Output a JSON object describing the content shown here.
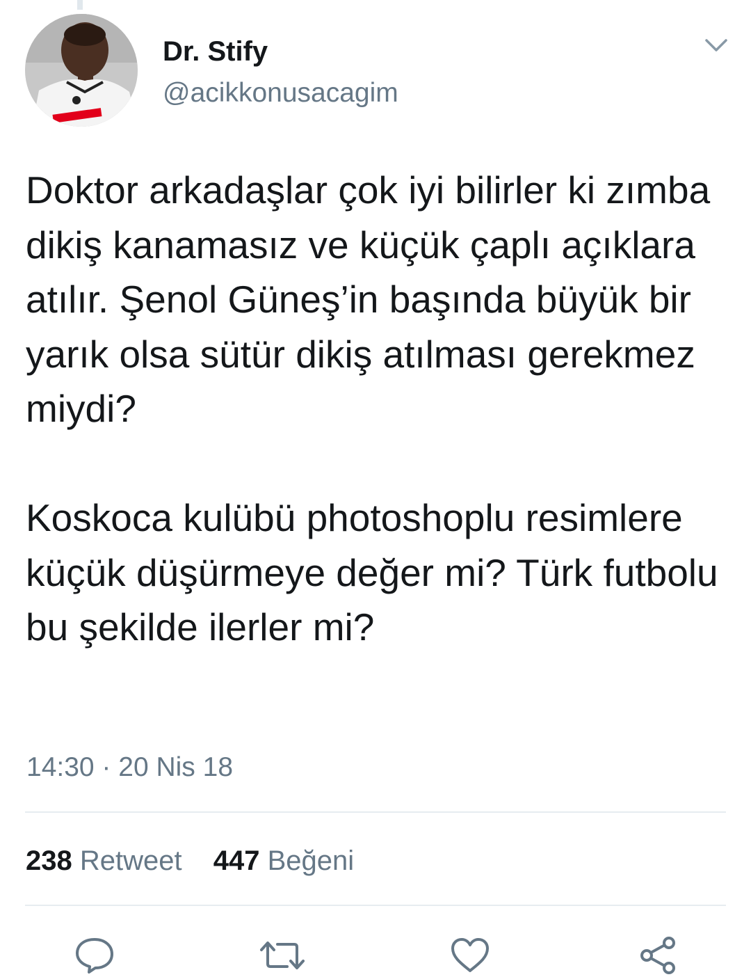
{
  "header": {
    "display_name": "Dr. Stify",
    "handle": "@acikkonusacagim"
  },
  "tweet": {
    "paragraphs": [
      "Doktor arkadaşlar çok iyi bilirler ki zımba dikiş kanamasız ve küçük çaplı açıklara atılır. Şenol Güneş’in başında büyük bir yarık olsa sütür dikiş atılması gerekmez miydi?",
      "Koskoca kulübü photoshoplu resimlere küçük düşürmeye değer mi? Türk futbolu bu şekilde ilerler mi?"
    ],
    "timestamp": "14:30 · 20 Nis 18"
  },
  "stats": {
    "retweet_count": "238",
    "retweet_label": "Retweet",
    "like_count": "447",
    "like_label": "Beğeni"
  },
  "actions": {
    "reply_icon": "reply-icon",
    "retweet_icon": "retweet-icon",
    "like_icon": "heart-icon",
    "share_icon": "share-icon"
  },
  "colors": {
    "text_primary": "#14171a",
    "text_secondary": "#657786",
    "icon": "#657786",
    "divider": "#e6ecf0"
  }
}
